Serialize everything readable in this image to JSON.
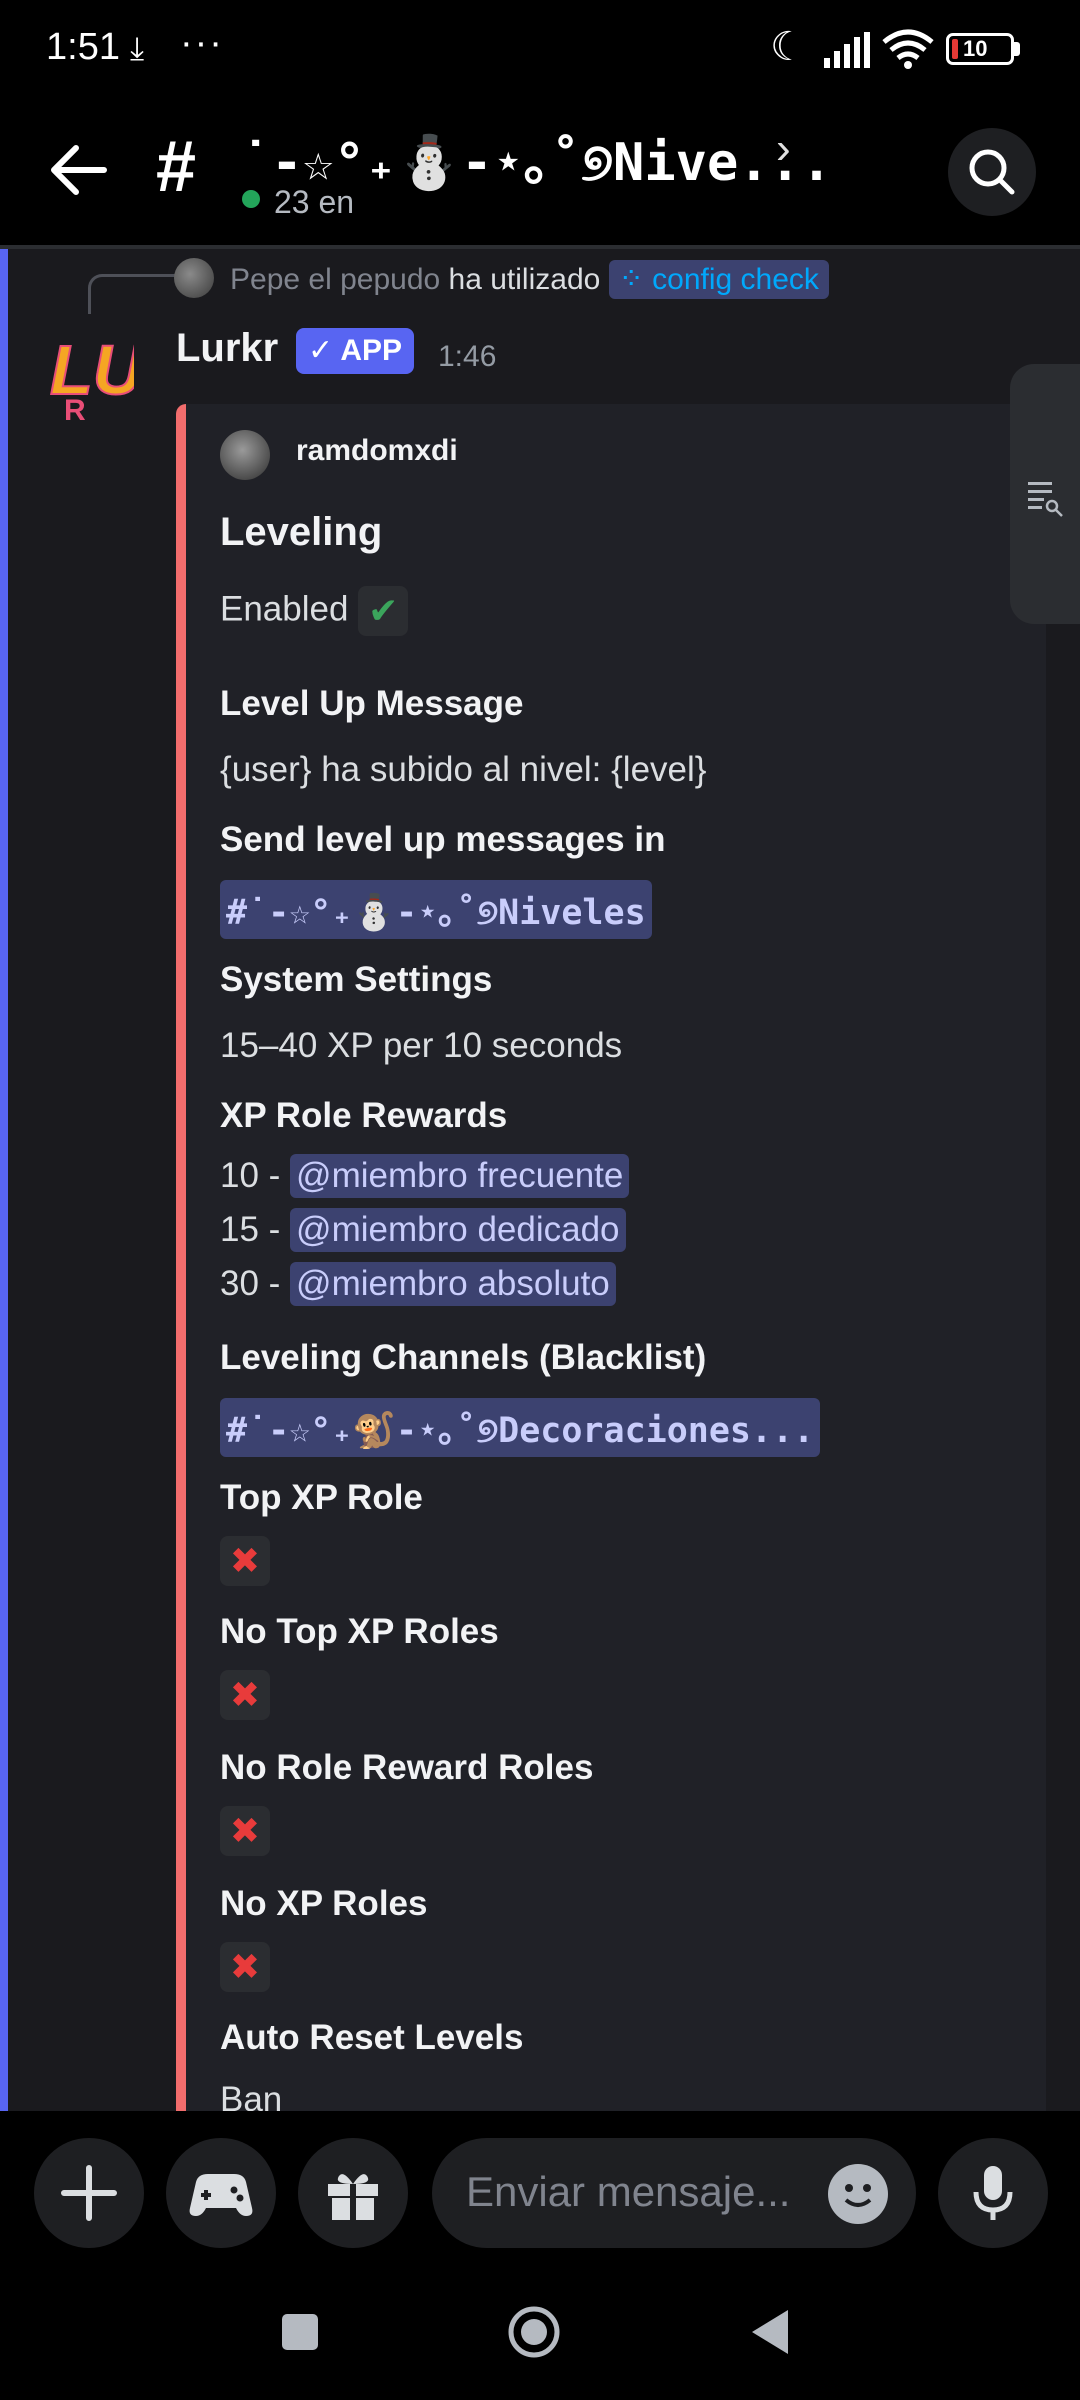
{
  "status_bar": {
    "time": "1:51",
    "download_icon": "⤓",
    "more": "···",
    "battery": "10"
  },
  "header": {
    "back_icon": "arrow-left",
    "hash": "#",
    "channel_name": "˙-☆°₊⛄-⋆｡˚୭Nive...",
    "chevron": "›",
    "online_count": "23 en",
    "search_icon": "search"
  },
  "reply": {
    "user": "Pepe el pepudo",
    "action": "ha utilizado",
    "command": "config check"
  },
  "message": {
    "author": "Lurkr",
    "badge": "✓ APP",
    "time": "1:46"
  },
  "embed": {
    "author": "ramdomxdi",
    "title": "Leveling",
    "enabled_label": "Enabled",
    "enabled_icon": "✔",
    "fields": {
      "level_up_message": {
        "name": "Level Up Message",
        "value": "{user} ha subido al nivel: {level}"
      },
      "send_level_up": {
        "name": "Send level up messages in",
        "value": "#˙-☆°₊⛄-⋆｡˚୭Niveles"
      },
      "system_settings": {
        "name": "System Settings",
        "value": "15–40 XP per 10 seconds"
      },
      "xp_role_rewards": {
        "name": "XP Role Rewards",
        "rows": [
          {
            "level": "10 -",
            "role": "@miembro frecuente"
          },
          {
            "level": "15 -",
            "role": "@miembro dedicado"
          },
          {
            "level": "30 -",
            "role": "@miembro absoluto"
          }
        ]
      },
      "leveling_channels": {
        "name": "Leveling Channels (Blacklist)",
        "value": "#˙-☆°₊🐒-⋆｡˚୭Decoraciones..."
      },
      "top_xp_role": {
        "name": "Top XP Role",
        "icon": "✖"
      },
      "no_top_xp_roles": {
        "name": "No Top XP Roles",
        "icon": "✖"
      },
      "no_role_reward_roles": {
        "name": "No Role Reward Roles",
        "icon": "✖"
      },
      "no_xp_roles": {
        "name": "No XP Roles",
        "icon": "✖"
      },
      "auto_reset_levels": {
        "name": "Auto Reset Levels",
        "value": "Ban"
      }
    }
  },
  "input": {
    "placeholder": "Enviar mensaje..."
  },
  "colors": {
    "accent": "#5865f2",
    "embed_bar": "#f26d6d",
    "online": "#23a55a",
    "command": "#00a8fc"
  }
}
